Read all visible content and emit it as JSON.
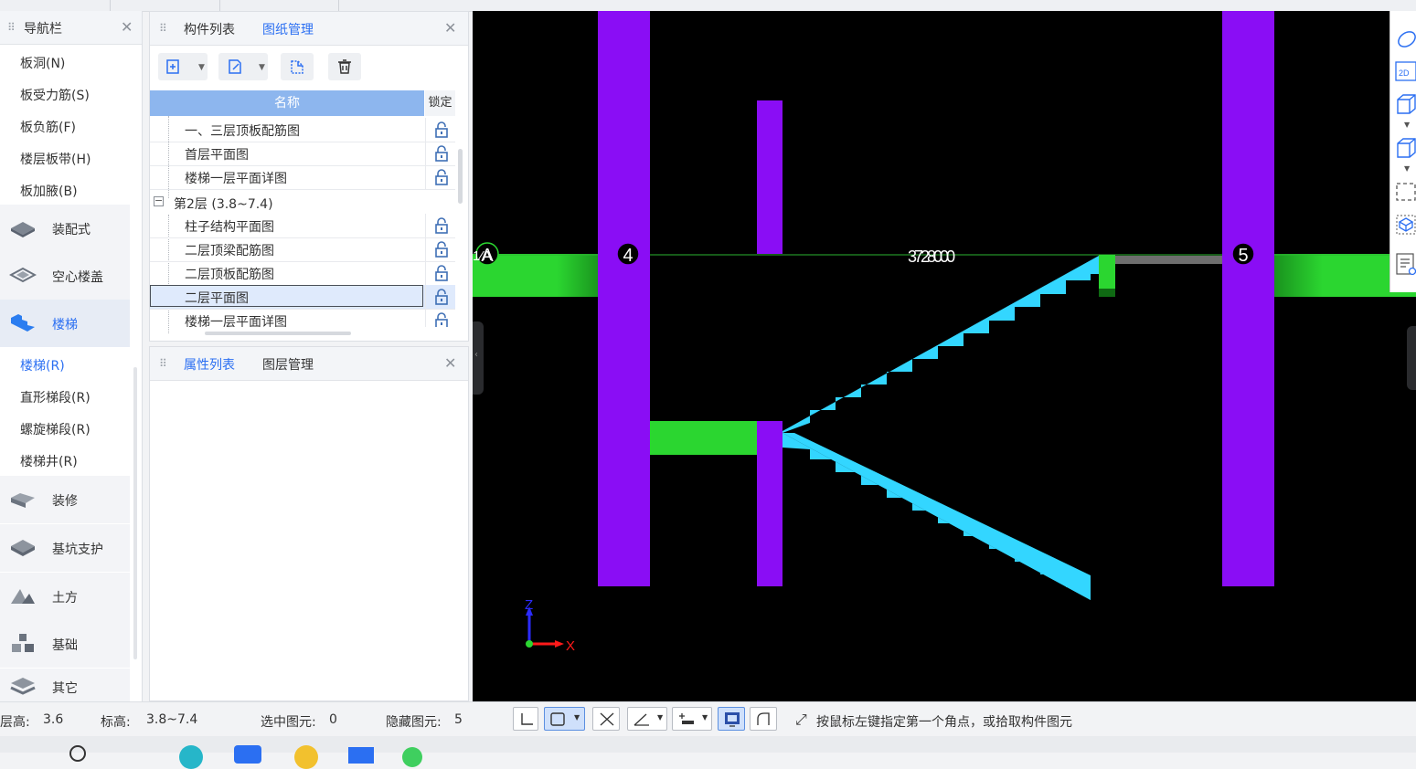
{
  "nav_panel": {
    "title": "导航栏",
    "items_top": [
      "板洞(N)",
      "板受力筋(S)",
      "板负筋(F)",
      "楼层板带(H)",
      "板加腋(B)"
    ],
    "categories_a": [
      "装配式",
      "空心楼盖",
      "楼梯"
    ],
    "stair_items": [
      "楼梯(R)",
      "直形梯段(R)",
      "螺旋梯段(R)",
      "楼梯井(R)"
    ],
    "categories_b": [
      "装修",
      "基坑支护",
      "土方",
      "基础",
      "其它"
    ]
  },
  "drawing_panel": {
    "tabs": [
      "构件列表",
      "图纸管理"
    ],
    "active_tab": "图纸管理",
    "columns": {
      "name": "名称",
      "lock": "锁定"
    },
    "rows_group1": [
      "一、三层顶板配筋图",
      "首层平面图",
      "楼梯一层平面详图"
    ],
    "group2": "第2层 (3.8~7.4)",
    "rows_group2": [
      "柱子结构平面图",
      "二层顶梁配筋图",
      "二层顶板配筋图",
      "二层平面图",
      "楼梯一层平面详图"
    ],
    "selected_row": "二层平面图"
  },
  "props_panel": {
    "tabs": [
      "属性列表",
      "图层管理"
    ],
    "active_tab": "属性列表"
  },
  "viewport": {
    "axis_a": "A",
    "axis_4": "4",
    "axis_5": "5",
    "dimension": "3728000",
    "left_edge_label": "1⁄A",
    "axis_z": "Z",
    "axis_x": "X",
    "colors": {
      "background": "#000000",
      "column": "#8a0df5",
      "beam": "#2bd630",
      "stair": "#33d6ff",
      "wall": "#6e6e6e"
    }
  },
  "status_bar": {
    "floor_height_label": "层高:",
    "floor_height": "3.6",
    "elevation_label": "标高:",
    "elevation": "3.8~7.4",
    "selected_label": "选中图元:",
    "selected_count": "0",
    "hidden_label": "隐藏图元:",
    "hidden_count": "5",
    "hint": "按鼠标左键指定第一个角点，或拾取构件图元"
  }
}
